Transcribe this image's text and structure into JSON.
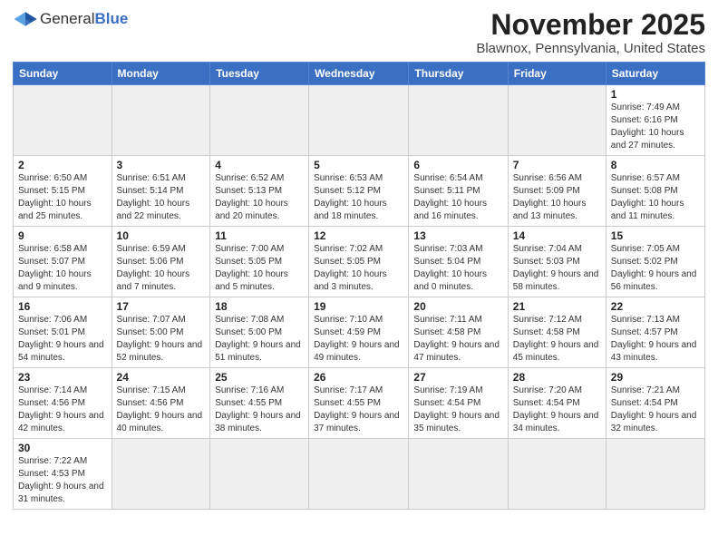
{
  "header": {
    "logo_general": "General",
    "logo_blue": "Blue",
    "month_title": "November 2025",
    "location": "Blawnox, Pennsylvania, United States"
  },
  "days_of_week": [
    "Sunday",
    "Monday",
    "Tuesday",
    "Wednesday",
    "Thursday",
    "Friday",
    "Saturday"
  ],
  "weeks": [
    [
      {
        "day": "",
        "info": "",
        "empty": true
      },
      {
        "day": "",
        "info": "",
        "empty": true
      },
      {
        "day": "",
        "info": "",
        "empty": true
      },
      {
        "day": "",
        "info": "",
        "empty": true
      },
      {
        "day": "",
        "info": "",
        "empty": true
      },
      {
        "day": "",
        "info": "",
        "empty": true
      },
      {
        "day": "1",
        "info": "Sunrise: 7:49 AM\nSunset: 6:16 PM\nDaylight: 10 hours and 27 minutes."
      }
    ],
    [
      {
        "day": "2",
        "info": "Sunrise: 6:50 AM\nSunset: 5:15 PM\nDaylight: 10 hours and 25 minutes."
      },
      {
        "day": "3",
        "info": "Sunrise: 6:51 AM\nSunset: 5:14 PM\nDaylight: 10 hours and 22 minutes."
      },
      {
        "day": "4",
        "info": "Sunrise: 6:52 AM\nSunset: 5:13 PM\nDaylight: 10 hours and 20 minutes."
      },
      {
        "day": "5",
        "info": "Sunrise: 6:53 AM\nSunset: 5:12 PM\nDaylight: 10 hours and 18 minutes."
      },
      {
        "day": "6",
        "info": "Sunrise: 6:54 AM\nSunset: 5:11 PM\nDaylight: 10 hours and 16 minutes."
      },
      {
        "day": "7",
        "info": "Sunrise: 6:56 AM\nSunset: 5:09 PM\nDaylight: 10 hours and 13 minutes."
      },
      {
        "day": "8",
        "info": "Sunrise: 6:57 AM\nSunset: 5:08 PM\nDaylight: 10 hours and 11 minutes."
      }
    ],
    [
      {
        "day": "9",
        "info": "Sunrise: 6:58 AM\nSunset: 5:07 PM\nDaylight: 10 hours and 9 minutes."
      },
      {
        "day": "10",
        "info": "Sunrise: 6:59 AM\nSunset: 5:06 PM\nDaylight: 10 hours and 7 minutes."
      },
      {
        "day": "11",
        "info": "Sunrise: 7:00 AM\nSunset: 5:05 PM\nDaylight: 10 hours and 5 minutes."
      },
      {
        "day": "12",
        "info": "Sunrise: 7:02 AM\nSunset: 5:05 PM\nDaylight: 10 hours and 3 minutes."
      },
      {
        "day": "13",
        "info": "Sunrise: 7:03 AM\nSunset: 5:04 PM\nDaylight: 10 hours and 0 minutes."
      },
      {
        "day": "14",
        "info": "Sunrise: 7:04 AM\nSunset: 5:03 PM\nDaylight: 9 hours and 58 minutes."
      },
      {
        "day": "15",
        "info": "Sunrise: 7:05 AM\nSunset: 5:02 PM\nDaylight: 9 hours and 56 minutes."
      }
    ],
    [
      {
        "day": "16",
        "info": "Sunrise: 7:06 AM\nSunset: 5:01 PM\nDaylight: 9 hours and 54 minutes."
      },
      {
        "day": "17",
        "info": "Sunrise: 7:07 AM\nSunset: 5:00 PM\nDaylight: 9 hours and 52 minutes."
      },
      {
        "day": "18",
        "info": "Sunrise: 7:08 AM\nSunset: 5:00 PM\nDaylight: 9 hours and 51 minutes."
      },
      {
        "day": "19",
        "info": "Sunrise: 7:10 AM\nSunset: 4:59 PM\nDaylight: 9 hours and 49 minutes."
      },
      {
        "day": "20",
        "info": "Sunrise: 7:11 AM\nSunset: 4:58 PM\nDaylight: 9 hours and 47 minutes."
      },
      {
        "day": "21",
        "info": "Sunrise: 7:12 AM\nSunset: 4:58 PM\nDaylight: 9 hours and 45 minutes."
      },
      {
        "day": "22",
        "info": "Sunrise: 7:13 AM\nSunset: 4:57 PM\nDaylight: 9 hours and 43 minutes."
      }
    ],
    [
      {
        "day": "23",
        "info": "Sunrise: 7:14 AM\nSunset: 4:56 PM\nDaylight: 9 hours and 42 minutes."
      },
      {
        "day": "24",
        "info": "Sunrise: 7:15 AM\nSunset: 4:56 PM\nDaylight: 9 hours and 40 minutes."
      },
      {
        "day": "25",
        "info": "Sunrise: 7:16 AM\nSunset: 4:55 PM\nDaylight: 9 hours and 38 minutes."
      },
      {
        "day": "26",
        "info": "Sunrise: 7:17 AM\nSunset: 4:55 PM\nDaylight: 9 hours and 37 minutes."
      },
      {
        "day": "27",
        "info": "Sunrise: 7:19 AM\nSunset: 4:54 PM\nDaylight: 9 hours and 35 minutes."
      },
      {
        "day": "28",
        "info": "Sunrise: 7:20 AM\nSunset: 4:54 PM\nDaylight: 9 hours and 34 minutes."
      },
      {
        "day": "29",
        "info": "Sunrise: 7:21 AM\nSunset: 4:54 PM\nDaylight: 9 hours and 32 minutes."
      }
    ],
    [
      {
        "day": "30",
        "info": "Sunrise: 7:22 AM\nSunset: 4:53 PM\nDaylight: 9 hours and 31 minutes."
      },
      {
        "day": "",
        "info": "",
        "empty": true
      },
      {
        "day": "",
        "info": "",
        "empty": true
      },
      {
        "day": "",
        "info": "",
        "empty": true
      },
      {
        "day": "",
        "info": "",
        "empty": true
      },
      {
        "day": "",
        "info": "",
        "empty": true
      },
      {
        "day": "",
        "info": "",
        "empty": true
      }
    ]
  ]
}
